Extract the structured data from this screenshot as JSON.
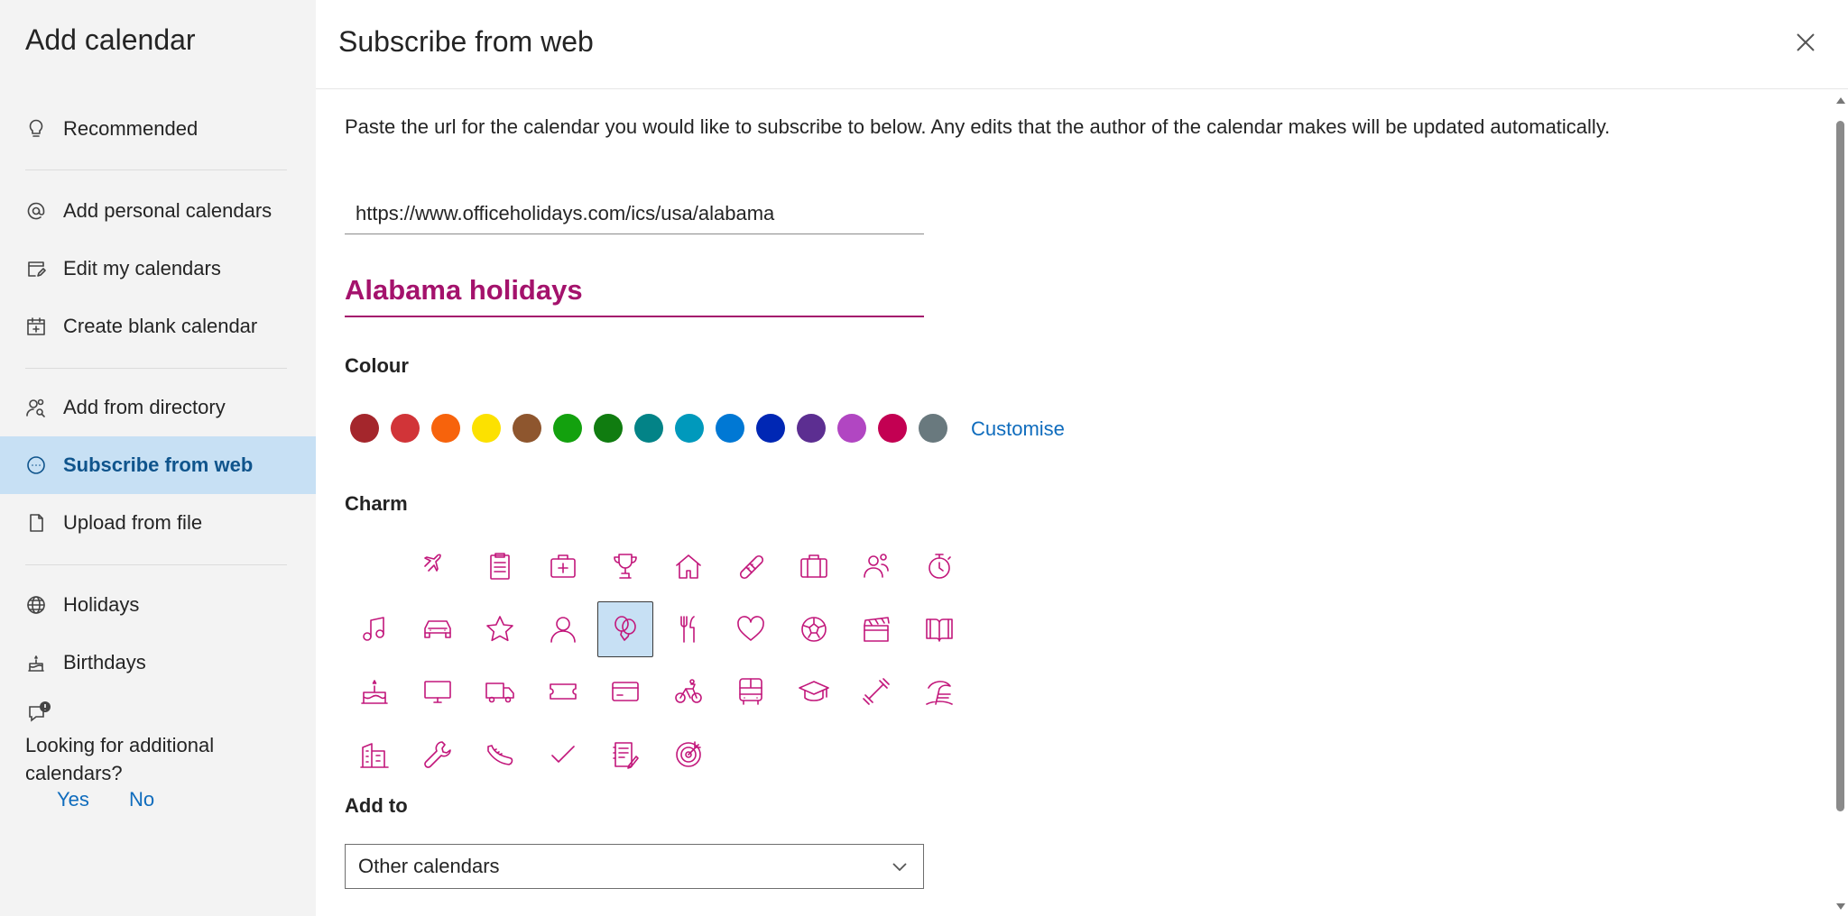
{
  "sidebar": {
    "title": "Add calendar",
    "items": [
      {
        "label": "Recommended",
        "icon": "lightbulb-icon"
      },
      {
        "label": "Add personal calendars",
        "icon": "at-sign-icon"
      },
      {
        "label": "Edit my calendars",
        "icon": "edit-calendar-icon"
      },
      {
        "label": "Create blank calendar",
        "icon": "calendar-add-icon"
      },
      {
        "label": "Add from directory",
        "icon": "people-search-icon"
      },
      {
        "label": "Subscribe from web",
        "icon": "link-circle-icon",
        "selected": true
      },
      {
        "label": "Upload from file",
        "icon": "document-icon"
      },
      {
        "label": "Holidays",
        "icon": "globe-icon"
      },
      {
        "label": "Birthdays",
        "icon": "cake-icon"
      }
    ],
    "feedback": {
      "text": "Looking for additional calendars?",
      "yes": "Yes",
      "no": "No"
    }
  },
  "main": {
    "title": "Subscribe from web",
    "description": "Paste the url for the calendar you would like to subscribe to below. Any edits that the author of the calendar makes will be updated automatically.",
    "url_value": "https://www.officeholidays.com/ics/usa/alabama",
    "calendar_name": "Alabama holidays",
    "colour_label": "Colour",
    "colours": [
      "#a4262c",
      "#d13438",
      "#f7630c",
      "#fce100",
      "#8e562e",
      "#13a10e",
      "#107c10",
      "#038387",
      "#0099bc",
      "#0078d4",
      "#0027b4",
      "#5c2e91",
      "#b146c2",
      "#c30052",
      "#69797e"
    ],
    "customise_label": "Customise",
    "charm_label": "Charm",
    "charms": [
      "none",
      "airplane-icon",
      "clipboard-icon",
      "medical-kit-icon",
      "trophy-icon",
      "home-icon",
      "bandage-icon",
      "briefcase-icon",
      "people-icon",
      "stopwatch-icon",
      "music-note-icon",
      "car-icon",
      "star-icon",
      "person-icon",
      "balloon-icon",
      "fork-knife-icon",
      "heart-icon",
      "soccer-ball-icon",
      "clapperboard-icon",
      "book-icon",
      "birthday-cake-icon",
      "monitor-icon",
      "truck-icon",
      "ticket-icon",
      "credit-card-icon",
      "bicycle-icon",
      "bus-icon",
      "graduation-cap-icon",
      "dumbbell-icon",
      "beach-icon",
      "building-icon",
      "wrench-icon",
      "sneaker-icon",
      "checkmark-icon",
      "notepad-icon",
      "target-icon"
    ],
    "selected_charm": "balloon-icon",
    "add_to_label": "Add to",
    "add_to_value": "Other calendars"
  }
}
